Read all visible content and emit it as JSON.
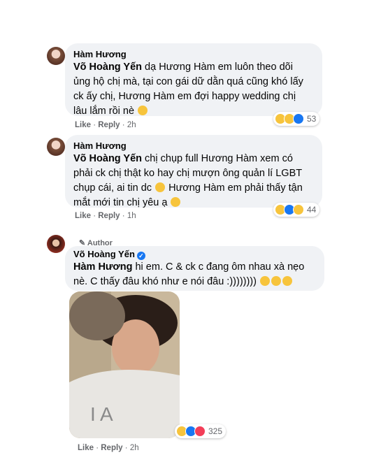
{
  "comments": [
    {
      "author": "Hàm Hương",
      "mention": "Võ Hoàng Yến",
      "text": " dạ Hương Hàm em luôn theo dõi\nủng hộ chị mà, tại con gái dữ dằn quá cũng khó lấy\nck ấy chị, Hương Hàm em đợi happy wedding chị\nlâu lắm rồi nè",
      "reaction_count": "53",
      "like": "Like",
      "reply": "Reply",
      "time": "2h"
    },
    {
      "author": "Hàm Hương",
      "mention": "Võ Hoàng Yến",
      "text_1": " chị chụp full Hương Hàm xem có\nphải ck chị thật ko hay chị mượn ông quản lí LGBT\nchụp cái, ai tin dc",
      "text_2": " Hương Hàm em phải thấy tận\nmắt mới tin chị yêu ạ",
      "reaction_count": "44",
      "like": "Like",
      "reply": "Reply",
      "time": "1h"
    },
    {
      "author_badge": "Author",
      "author": "Võ Hoàng Yến",
      "mention": "Hàm Hương",
      "text": " hi em. C & ck c đang ôm nhau xà nẹo\nnè. C thấy đâu khó như e nói đâu :))))))))",
      "reaction_count": "325",
      "like": "Like",
      "reply": "Reply",
      "time": "2h"
    }
  ],
  "colors": {
    "bubble": "#f0f2f5",
    "like_blue": "#1877f2",
    "meta_gray": "#65676b"
  }
}
